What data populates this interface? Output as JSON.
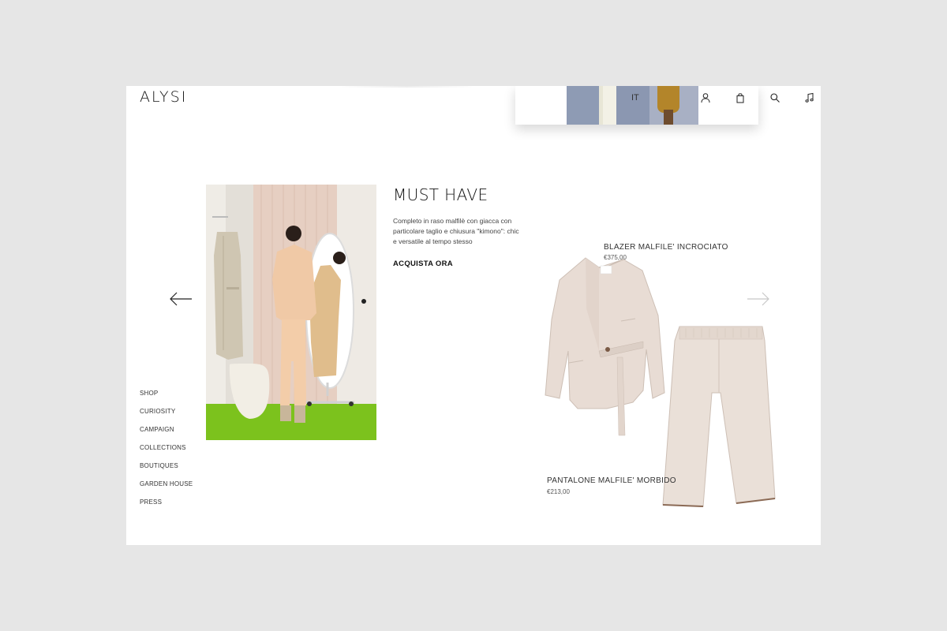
{
  "header": {
    "logo": "ALYSI",
    "language": "IT",
    "icons": [
      "user-icon",
      "bag-icon",
      "search-icon",
      "music-icon"
    ]
  },
  "nav": {
    "items": [
      "SHOP",
      "CURIOSITY",
      "CAMPAIGN",
      "COLLECTIONS",
      "BOUTIQUES",
      "GARDEN HOUSE",
      "PRESS"
    ]
  },
  "feature": {
    "headline": "MUST HAVE",
    "description": "Completo in raso malfilè con giacca con particolare taglio e chiusura \"kimono\": chic e versatile al tempo stesso",
    "cta": "ACQUISTA ORA"
  },
  "products": [
    {
      "name": "BLAZER MALFILE' INCROCIATO",
      "price": "€375,00"
    },
    {
      "name": "PANTALONE MALFILE' MORBIDO",
      "price": "€213,00"
    }
  ],
  "colors": {
    "page_bg": "#e6e6e6",
    "content_bg": "#ffffff",
    "text": "#222222",
    "garment": "#e8dcd4",
    "floor": "#7cc21d"
  }
}
